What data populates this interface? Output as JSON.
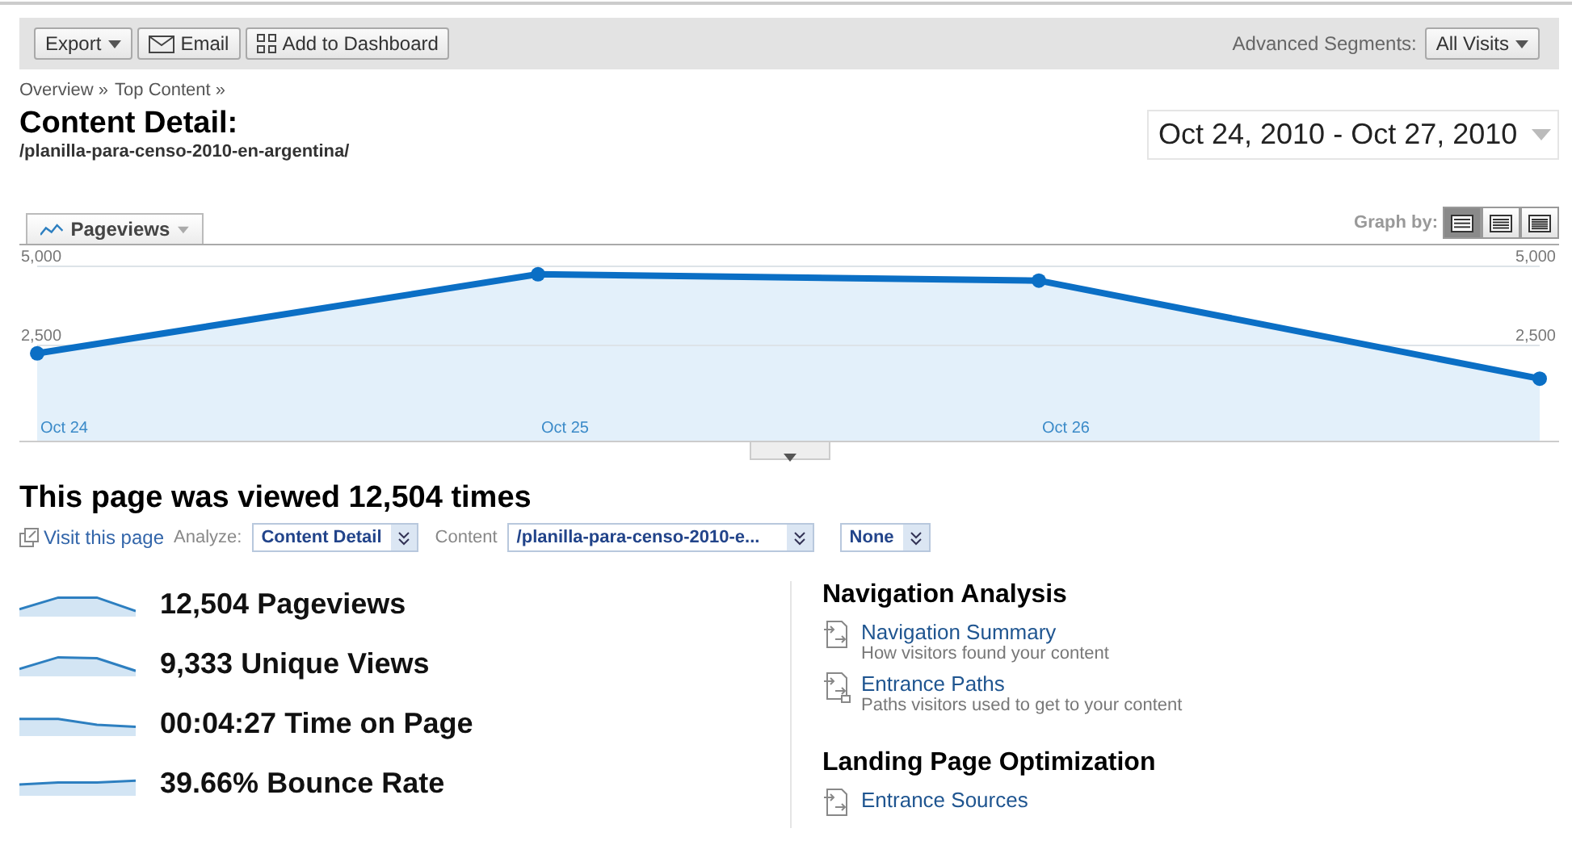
{
  "toolbar": {
    "buttons": [
      {
        "label": "Export",
        "kind": "dropdown"
      },
      {
        "label": "Email",
        "kind": "email"
      },
      {
        "label": "Add to Dashboard",
        "kind": "dashboard"
      }
    ],
    "segments_label": "Advanced Segments:",
    "segments_value": "All Visits"
  },
  "breadcrumb": [
    "Overview »",
    "Top Content »"
  ],
  "title": "Content Detail:",
  "path": "/planilla-para-censo-2010-en-argentina/",
  "date_range": "Oct 24, 2010 - Oct 27, 2010",
  "graph": {
    "graph_by_label": "Graph by:",
    "graph_by": [
      {
        "kind": "day",
        "selected": true
      },
      {
        "kind": "week",
        "selected": false
      },
      {
        "kind": "month",
        "selected": false
      }
    ],
    "chart_data": {
      "type": "area",
      "categories": [
        "Oct 24",
        "Oct 25",
        "Oct 26",
        null
      ],
      "yticks": [
        {
          "value": 2500,
          "label": "2,500"
        },
        {
          "value": 5000,
          "label": "5,000"
        }
      ],
      "ylim": [
        0,
        5000
      ],
      "series": [
        {
          "name": "Pageviews",
          "color": "#0b6fc5",
          "values": [
            2250,
            4750,
            4550,
            1450
          ]
        }
      ]
    }
  },
  "summary": "This page was viewed 12,504 times",
  "controls": {
    "visit_link": "Visit this page",
    "analyze_label": "Analyze:",
    "analyze_value": "Content Detail",
    "content_label": "Content",
    "content_value": "/planilla-para-censo-2010-e...",
    "segment_value": "None"
  },
  "metrics": [
    {
      "value": "12,504",
      "label": "Pageviews"
    },
    {
      "value": "9,333",
      "label": "Unique Views"
    },
    {
      "value": "00:04:27",
      "label": "Time on Page"
    },
    {
      "value": "39.66%",
      "label": "Bounce Rate"
    }
  ],
  "sections": [
    {
      "title": "Navigation Analysis",
      "links": [
        {
          "label": "Navigation Summary",
          "description": "How visitors found your content"
        },
        {
          "label": "Entrance Paths",
          "description": "Paths visitors used to get to your content"
        }
      ]
    },
    {
      "title": "Landing Page Optimization",
      "links": [
        {
          "label": "Entrance Sources"
        }
      ]
    }
  ]
}
